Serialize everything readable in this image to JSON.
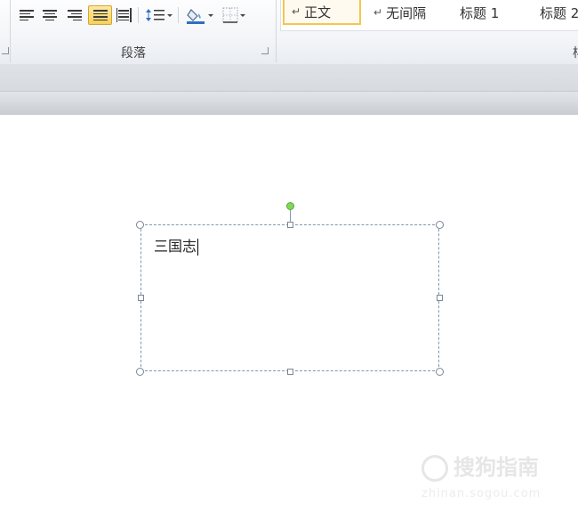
{
  "ribbon": {
    "paragraph_group": {
      "label": "段落",
      "tools": [
        "align-left-icon",
        "align-center-icon",
        "align-right-icon",
        "justify-icon",
        "distributed-icon",
        "line-spacing-icon",
        "shading-icon",
        "borders-icon"
      ],
      "active_tool": "justify-icon"
    },
    "styles_group": {
      "items": [
        {
          "label": "正文",
          "selected": true,
          "para_mark": "↵"
        },
        {
          "label": "无间隔",
          "selected": false,
          "para_mark": "↵"
        },
        {
          "label": "标题 1",
          "selected": false
        },
        {
          "label": "标题 2",
          "selected": false
        }
      ],
      "label_partial": "样"
    },
    "accent": "#f7cf5c"
  },
  "document": {
    "textbox": {
      "text": "三国志"
    }
  },
  "watermark": {
    "brand": "搜狗指南",
    "url": "zhinan.sogou.com"
  }
}
